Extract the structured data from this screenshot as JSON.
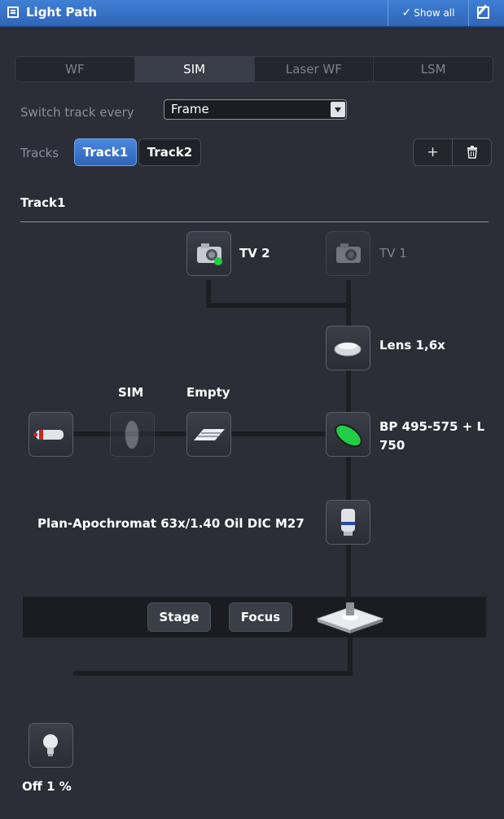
{
  "window": {
    "title": "Light Path",
    "show_all_label": "Show all"
  },
  "mode_tabs": [
    {
      "label": "WF",
      "active": false
    },
    {
      "label": "SIM",
      "active": true
    },
    {
      "label": "Laser WF",
      "active": false
    },
    {
      "label": "LSM",
      "active": false
    }
  ],
  "switch_track": {
    "label": "Switch track every",
    "value": "Frame"
  },
  "tracks": {
    "label": "Tracks",
    "items": [
      "Track1",
      "Track2"
    ],
    "selected": "Track1",
    "add_label": "+",
    "remove_icon": "trash-icon"
  },
  "current_track": "Track1",
  "components": {
    "tv2": {
      "label": "TV 2",
      "icon": "camera-icon"
    },
    "tv1": {
      "label": "TV 1",
      "icon": "camera-icon"
    },
    "lens": {
      "label": "Lens 1,6x",
      "icon": "lens-icon"
    },
    "sim": {
      "label": "SIM",
      "icon": "sim-grating-icon"
    },
    "empty": {
      "label": "Empty",
      "icon": "filter-slider-icon"
    },
    "filter": {
      "label_line1": "BP 495-575 + L",
      "label_line2": "750",
      "icon": "filter-icon",
      "color": "#22cc44"
    },
    "laser": {
      "icon": "laser-icon"
    },
    "objective": {
      "label": "Plan-Apochromat 63x/1.40 Oil DIC M27",
      "icon": "objective-icon"
    },
    "stage": {
      "stage_label": "Stage",
      "focus_label": "Focus",
      "icon": "stage-icon"
    },
    "lamp": {
      "label": "Off 1 %",
      "icon": "lamp-icon"
    }
  },
  "colors": {
    "accent": "#3f7fd4",
    "background": "#2b2e36",
    "filter_green": "#22cc44"
  }
}
